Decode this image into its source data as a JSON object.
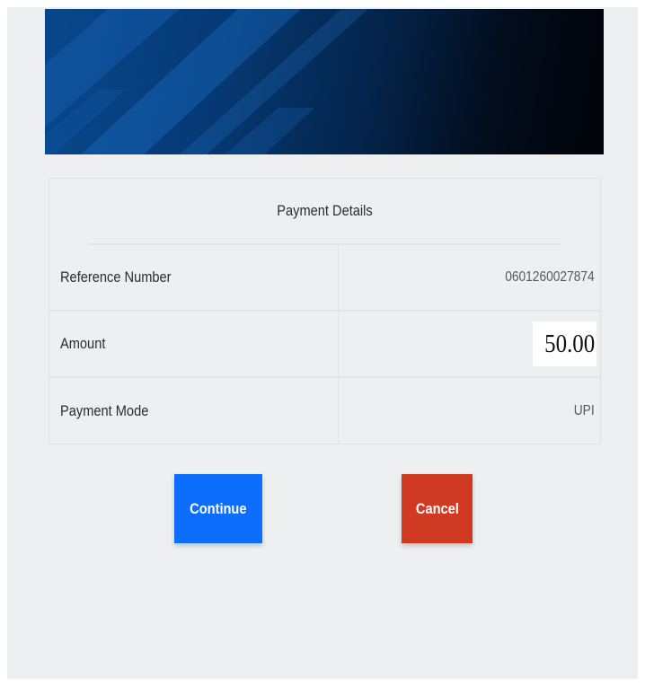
{
  "payment_details": {
    "title": "Payment Details",
    "rows": [
      {
        "label": "Reference Number",
        "value": "0601260027874"
      },
      {
        "label": "Amount",
        "value": "50.00"
      },
      {
        "label": "Payment Mode",
        "value": "UPI"
      }
    ]
  },
  "actions": {
    "continue_label": "Continue",
    "cancel_label": "Cancel"
  },
  "colors": {
    "continue": "#0d6efd",
    "cancel": "#d13a22",
    "background": "#edeff1",
    "banner_dark": "#01040a",
    "banner_blue": "#08478c"
  }
}
